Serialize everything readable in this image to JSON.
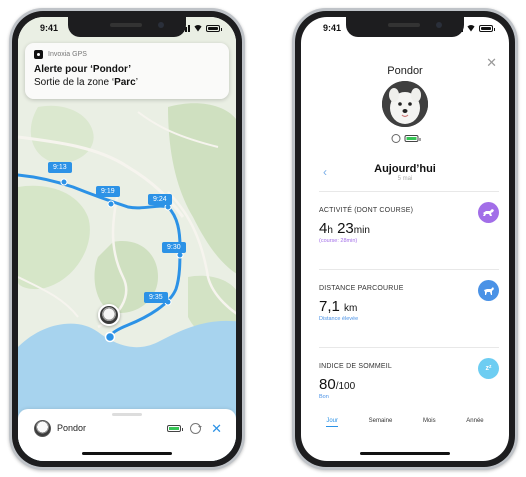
{
  "left_phone": {
    "status": {
      "time": "9:41"
    },
    "notification": {
      "app_name": "Invoxia GPS",
      "title": "Alerte pour ‘Pondor’",
      "body_prefix": "Sortie de la zone ‘",
      "body_zone": "Parc",
      "body_suffix": "’"
    },
    "timeline_labels": [
      "9:13",
      "9:19",
      "9:24",
      "9:30",
      "9:35"
    ],
    "bottom_sheet": {
      "pet_name": "Pondor",
      "icons": [
        "dog-avatar-icon",
        "battery-icon",
        "sync-icon",
        "close-icon"
      ]
    },
    "colors": {
      "route": "#2c92e6",
      "water": "#a7d3ee",
      "land": "#e9eee4",
      "forest": "#cfe0c0"
    }
  },
  "right_phone": {
    "status": {
      "time": "9:41"
    },
    "header": {
      "pet_name": "Pondor"
    },
    "date_nav": {
      "title": "Aujourd’hui",
      "subtitle": "5 mai"
    },
    "activity": {
      "title": "ACTIVITÉ (DONT COURSE)",
      "hours": "4",
      "hours_unit": "h",
      "minutes": "23",
      "minutes_unit": "min",
      "sub": "(course: 28min)",
      "icon": "running-dog-icon",
      "color": "#a26ee8"
    },
    "distance": {
      "title": "DISTANCE PARCOURUE",
      "value": "7,1",
      "unit": "km",
      "sub": "Distance élevée",
      "icon": "walking-dog-icon",
      "color": "#4a92e6"
    },
    "sleep": {
      "title": "INDICE DE SOMMEIL",
      "value": "80",
      "unit": "/100",
      "sub": "Bon",
      "icon": "sleep-zz-icon",
      "color": "#6dcdf2"
    },
    "tabs": {
      "day": "Jour",
      "week": "Semaine",
      "month": "Mois",
      "year": "Année",
      "active": "day"
    }
  }
}
